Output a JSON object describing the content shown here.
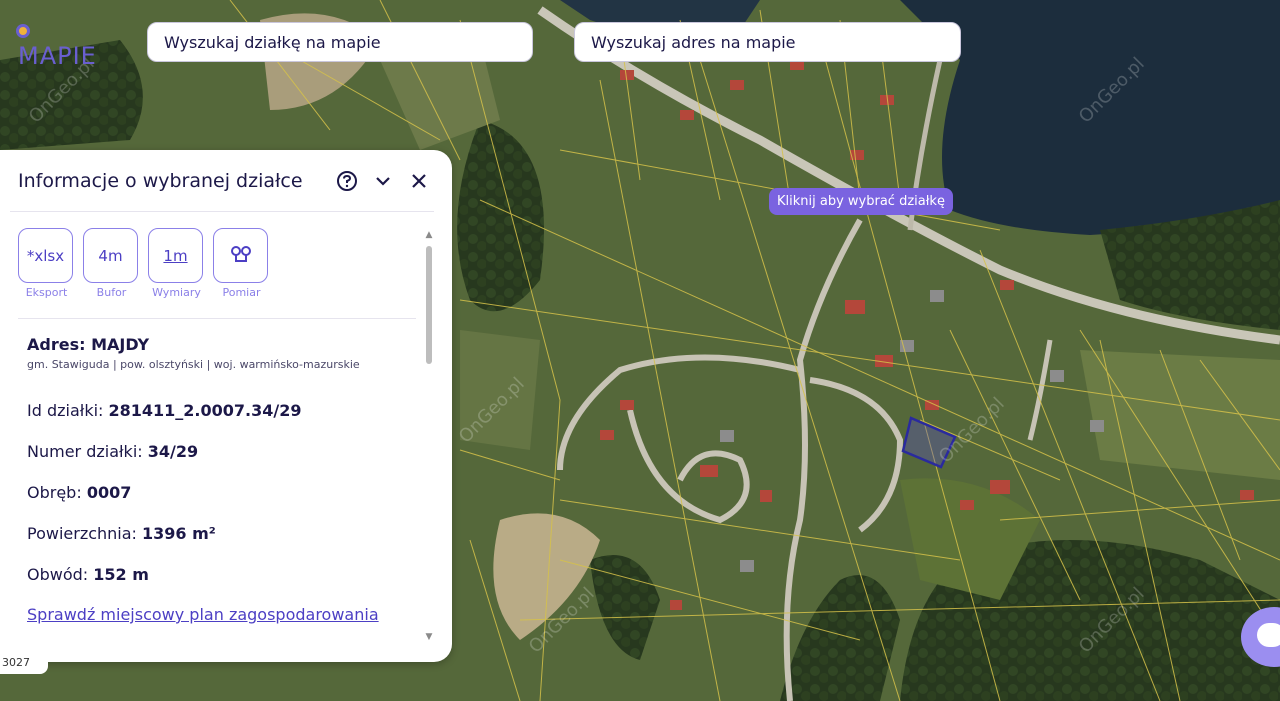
{
  "app": {
    "logo_text": "MAPIE"
  },
  "search": {
    "parcel_placeholder": "Wyszukaj działkę na mapie",
    "address_placeholder": "Wyszukaj adres na mapie"
  },
  "map": {
    "tooltip": "Kliknij aby wybrać działkę",
    "watermark": "OnGeo.pl",
    "scale_chip": "3027"
  },
  "panel": {
    "title": "Informacje o wybranej działce",
    "tools": [
      {
        "icon_text": "*xlsx",
        "label": "Eksport",
        "icon": "xlsx-icon"
      },
      {
        "icon_text": "4m",
        "label": "Bufor",
        "icon": "buffer-icon"
      },
      {
        "icon_text": "1m",
        "label": "Wymiary",
        "icon": "dimensions-icon"
      },
      {
        "icon_text": "",
        "label": "Pomiar",
        "icon": "measure-icon"
      }
    ],
    "address_label": "Adres: MAJDY",
    "address_sub": "gm. Stawiguda | pow. olsztyński | woj. warmińsko-mazurskie",
    "fields": [
      {
        "label": "Id działki: ",
        "value": "281411_2.0007.34/29"
      },
      {
        "label": "Numer działki: ",
        "value": "34/29"
      },
      {
        "label": "Obręb: ",
        "value": "0007"
      },
      {
        "label": "Powierzchnia: ",
        "value": "1396 m²"
      },
      {
        "label": "Obwód: ",
        "value": "152 m"
      }
    ],
    "plan_link": "Sprawdź miejscowy plan zagospodarowania"
  }
}
